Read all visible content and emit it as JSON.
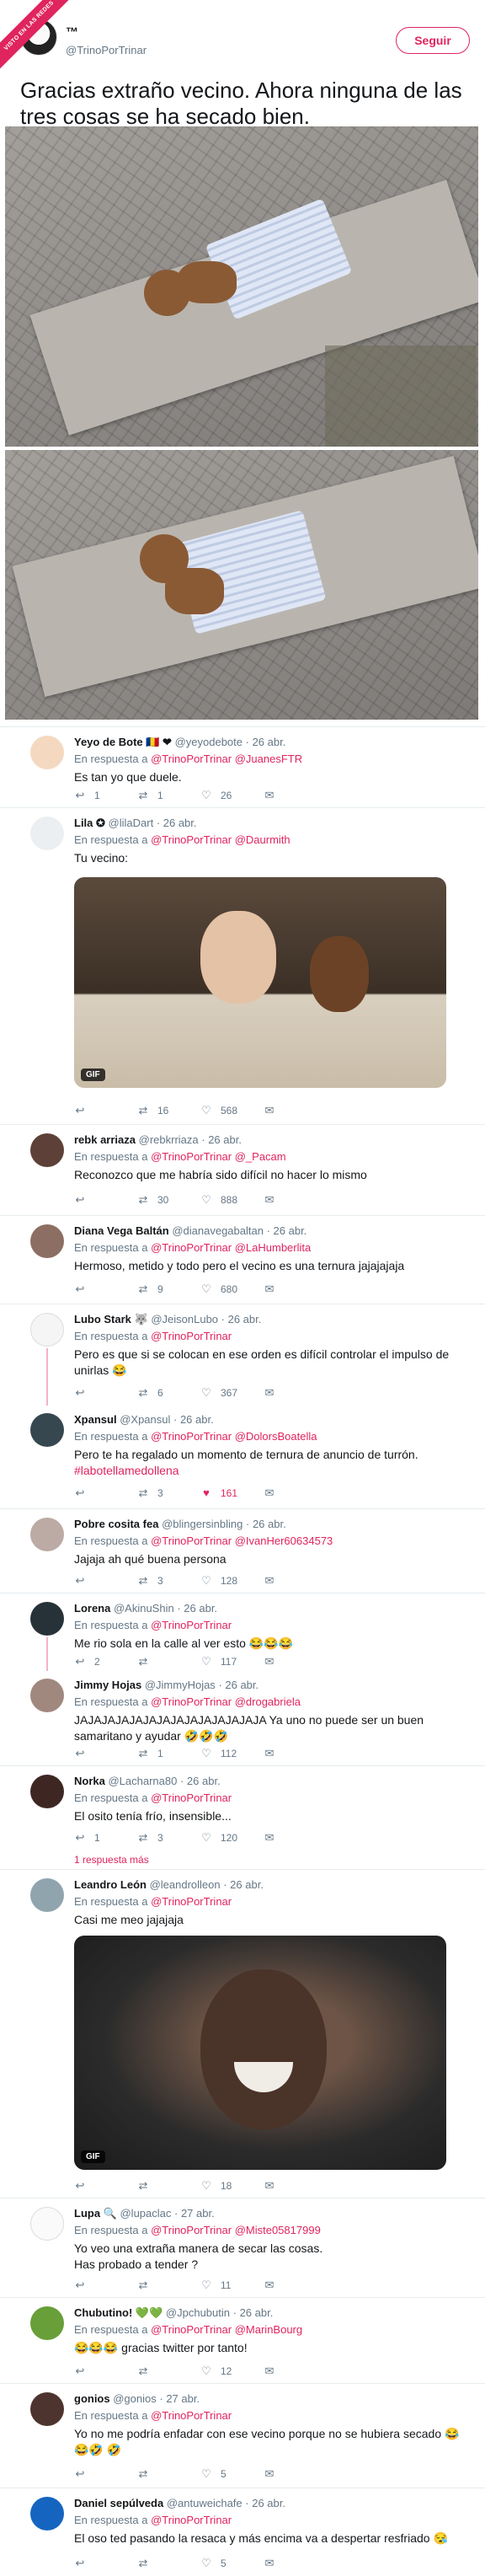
{
  "watermark": "VISTO EN LAS REDES",
  "main": {
    "author_name": "™",
    "author_handle": "@TrinoPorTrinar",
    "follow_label": "Seguir",
    "text": "Gracias extraño vecino. Ahora ninguna de las tres cosas se ha secado bien."
  },
  "replies": [
    {
      "name": "Yeyo de Bote 🇷🇴 ❤",
      "handle": "@yeyodebote",
      "time": "· 26 abr.",
      "in_reply_prefix": "En respuesta a",
      "in_reply": "@TrinoPorTrinar @JuanesFTR",
      "text": "Es tan yo que duele.",
      "reply_count": "1",
      "retweets": "1",
      "likes": "26"
    },
    {
      "name": "Lila ✪",
      "handle": "@lilaDart",
      "time": "· 26 abr.",
      "in_reply_prefix": "En respuesta a",
      "in_reply": "@TrinoPorTrinar @Daurmith",
      "text": "Tu vecino:",
      "media_label": "GIF",
      "reply_count": "",
      "retweets": "16",
      "likes": "568"
    },
    {
      "name": "rebk arriaza",
      "handle": "@rebkrriaza",
      "time": "· 26 abr.",
      "in_reply_prefix": "En respuesta a",
      "in_reply": "@TrinoPorTrinar @_Pacam",
      "text": "Reconozco que me habría sido difícil no hacer lo mismo",
      "reply_count": "",
      "retweets": "30",
      "likes": "888"
    },
    {
      "name": "Diana Vega Baltán",
      "handle": "@dianavegabaltan",
      "time": "· 26 abr.",
      "in_reply_prefix": "En respuesta a",
      "in_reply": "@TrinoPorTrinar @LaHumberlita",
      "text": "Hermoso, metido y todo pero el vecino es una ternura jajajajaja",
      "reply_count": "",
      "retweets": "9",
      "likes": "680"
    },
    {
      "name": "Lubo Stark 🐺",
      "handle": "@JeisonLubo",
      "time": "· 26 abr.",
      "in_reply_prefix": "En respuesta a",
      "in_reply": "@TrinoPorTrinar",
      "text": "Pero es que si se colocan en ese orden es difícil controlar el impulso de unirlas 😂",
      "reply_count": "",
      "retweets": "6",
      "likes": "367"
    },
    {
      "name": "Xpansul",
      "handle": "@Xpansul",
      "time": "· 26 abr.",
      "in_reply_prefix": "En respuesta a",
      "in_reply": "@TrinoPorTrinar @DolorsBoatella",
      "text": "Pero te ha regalado un momento de ternura de anuncio de turrón.",
      "hashtag": "#labotellamedollena",
      "reply_count": "",
      "retweets": "3",
      "likes": "161"
    },
    {
      "name": "Pobre cosita fea",
      "handle": "@blingersinbling",
      "time": "· 26 abr.",
      "in_reply_prefix": "En respuesta a",
      "in_reply": "@TrinoPorTrinar @IvanHer60634573",
      "text": "Jajaja ah qué buena persona",
      "reply_count": "",
      "retweets": "3",
      "likes": "128"
    },
    {
      "name": "Lorena",
      "handle": "@AkinuShin",
      "time": "· 26 abr.",
      "in_reply_prefix": "En respuesta a",
      "in_reply": "@TrinoPorTrinar",
      "text": "Me rio sola en la calle al ver esto 😂😂😂",
      "reply_count": "2",
      "retweets": "",
      "likes": "117"
    },
    {
      "name": "Jimmy Hojas",
      "handle": "@JimmyHojas",
      "time": "· 26 abr.",
      "in_reply_prefix": "En respuesta a",
      "in_reply": "@TrinoPorTrinar @drogabriela",
      "text": "JAJAJAJAJAJAJAJAJAJAJAJAJAJA Ya uno no puede ser un buen samaritano y ayudar 🤣🤣🤣",
      "reply_count": "",
      "retweets": "1",
      "likes": "112"
    },
    {
      "name": "Norka",
      "handle": "@Lacharna80",
      "time": "· 26 abr.",
      "in_reply_prefix": "En respuesta a",
      "in_reply": "@TrinoPorTrinar",
      "text": "El osito tenía frío, insensible...",
      "reply_count": "1",
      "retweets": "3",
      "likes": "120",
      "more_replies": "1 respuesta más"
    },
    {
      "name": "Leandro León",
      "handle": "@leandrolleon",
      "time": "· 26 abr.",
      "in_reply_prefix": "En respuesta a",
      "in_reply": "@TrinoPorTrinar",
      "text": "Casi me meo jajajaja",
      "media_label": "GIF",
      "reply_count": "",
      "retweets": "",
      "likes": "18"
    },
    {
      "name": "Lupa 🔍",
      "handle": "@lupaclac",
      "time": "· 27 abr.",
      "in_reply_prefix": "En respuesta a",
      "in_reply": "@TrinoPorTrinar @Miste05817999",
      "text": "Yo veo una extraña manera de secar las cosas.",
      "text2": "Has probado a tender ?",
      "reply_count": "",
      "retweets": "",
      "likes": "11"
    },
    {
      "name": "Chubutino! 💚💚",
      "handle": "@Jpchubutin",
      "time": "· 26 abr.",
      "in_reply_prefix": "En respuesta a",
      "in_reply": "@TrinoPorTrinar @MarinBourg",
      "text": "😂😂😂 gracias twitter por tanto!",
      "reply_count": "",
      "retweets": "",
      "likes": "12"
    },
    {
      "name": "gonios",
      "handle": "@gonios",
      "time": "· 27 abr.",
      "in_reply_prefix": "En respuesta a",
      "in_reply": "@TrinoPorTrinar",
      "text": "Yo no me podría enfadar con ese vecino porque no se hubiera secado 😂😂🤣 🤣",
      "reply_count": "",
      "retweets": "",
      "likes": "5"
    },
    {
      "name": "Daniel sepúlveda",
      "handle": "@antuweichafe",
      "time": "· 26 abr.",
      "in_reply_prefix": "En respuesta a",
      "in_reply": "@TrinoPorTrinar",
      "text": "El oso ted pasando la resaca y más encima va a despertar resfriado 😪",
      "reply_count": "",
      "retweets": "",
      "likes": "5"
    }
  ],
  "icons": {
    "reply": "reply-icon",
    "retweet": "retweet-icon",
    "like": "heart-icon",
    "dm": "envelope-icon"
  },
  "colors": {
    "accent": "#e0245e",
    "muted": "#657786",
    "text": "#14171a"
  }
}
